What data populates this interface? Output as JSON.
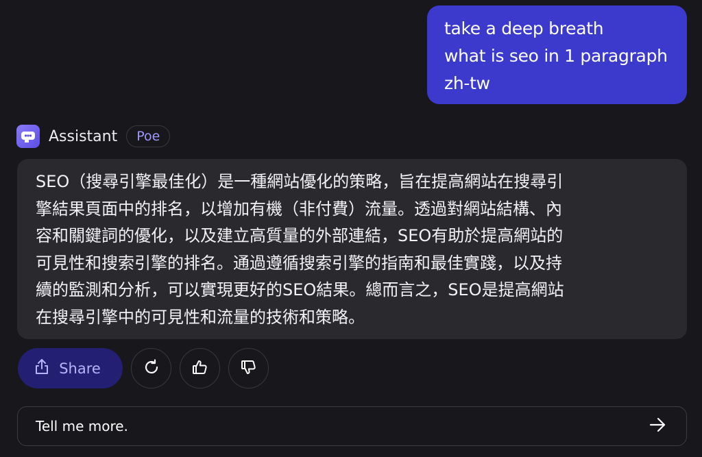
{
  "user_message": {
    "lines": [
      "take a deep breath",
      "what is seo in 1 paragraph",
      "zh-tw"
    ]
  },
  "bot": {
    "name": "Assistant",
    "badge": "Poe",
    "response_lines": [
      "SEO（搜尋引擎最佳化）是一種網站優化的策略，旨在提高網站在搜尋引",
      "擎結果頁面中的排名，以增加有機（非付費）流量。透過對網站結構、內",
      "容和關鍵詞的優化，以及建立高質量的外部連結，SEO有助於提高網站的",
      "可見性和搜索引擎的排名。通過遵循搜索引擎的指南和最佳實踐，以及持",
      "續的監測和分析，可以實現更好的SEO結果。總而言之，SEO是提高網站",
      "在搜尋引擎中的可見性和流量的技術和策略。"
    ]
  },
  "actions": {
    "share_label": "Share"
  },
  "input": {
    "value": "Tell me more."
  },
  "icons": {
    "avatar": "robot-icon",
    "share": "share-icon",
    "retry": "retry-icon",
    "like": "thumbs-up-icon",
    "dislike": "thumbs-down-icon",
    "send": "arrow-right-icon"
  },
  "colors": {
    "background": "#18171b",
    "user_bubble": "#3b3acd",
    "bot_bubble": "#2a292e",
    "share_button": "#232074",
    "accent_text": "#9d98ff"
  }
}
